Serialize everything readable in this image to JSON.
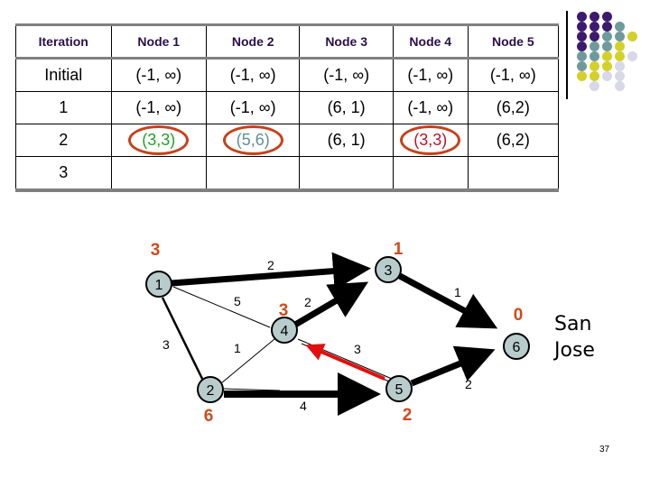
{
  "table": {
    "headers": [
      "Iteration",
      "Node 1",
      "Node 2",
      "Node 3",
      "Node 4",
      "Node 5"
    ],
    "rows": [
      {
        "iteration": "Initial",
        "cells": [
          "(-1, ∞)",
          "(-1, ∞)",
          "(-1, ∞)",
          "(-1, ∞)",
          "(-1, ∞)"
        ]
      },
      {
        "iteration": "1",
        "cells": [
          "(-1, ∞)",
          "(-1, ∞)",
          "(6, 1)",
          "(-1, ∞)",
          "(6,2)"
        ]
      },
      {
        "iteration": "2",
        "cells": [
          "(3,3)",
          "(5,6)",
          "(6, 1)",
          "(3,3)",
          "(6,2)"
        ]
      },
      {
        "iteration": "3",
        "cells": [
          "",
          "",
          "",
          "",
          ""
        ]
      }
    ],
    "highlighted": [
      {
        "row": 2,
        "col": 0,
        "color": "#22a02a"
      },
      {
        "row": 2,
        "col": 1,
        "color": "#5f8f95"
      },
      {
        "row": 2,
        "col": 3,
        "color": "#b4182a"
      }
    ],
    "circle_color": "#c8401a"
  },
  "graph": {
    "nodes": [
      {
        "id": "1",
        "distance": "3"
      },
      {
        "id": "2",
        "distance": "6"
      },
      {
        "id": "3",
        "distance": "1"
      },
      {
        "id": "4",
        "distance": "3"
      },
      {
        "id": "5",
        "distance": "2"
      },
      {
        "id": "6",
        "distance": "0"
      }
    ],
    "edges": [
      {
        "from": "1",
        "to": "3",
        "weight": "2",
        "style": "thick-arrow"
      },
      {
        "from": "1",
        "to": "4",
        "weight": "5",
        "style": "thin"
      },
      {
        "from": "1",
        "to": "2",
        "weight": "3",
        "style": "medium"
      },
      {
        "from": "2",
        "to": "4",
        "weight": "1",
        "style": "thin"
      },
      {
        "from": "2",
        "to": "5",
        "weight": "4",
        "style": "thick-arrow"
      },
      {
        "from": "4",
        "to": "3",
        "weight": "2",
        "style": "thick-arrow"
      },
      {
        "from": "5",
        "to": "4",
        "weight": "3",
        "style": "red-arrow"
      },
      {
        "from": "3",
        "to": "6",
        "weight": "1",
        "style": "thick-arrow"
      },
      {
        "from": "5",
        "to": "6",
        "weight": "2",
        "style": "thick-arrow"
      }
    ],
    "destination_label": [
      "San",
      "Jose"
    ],
    "colors": {
      "node_fill": "#b8cccc",
      "distance_text": "#d04a1a",
      "highlight_edge": "#e01010"
    }
  },
  "page_number": "37",
  "logo": {
    "colors": [
      "#3d1a6e",
      "#6f9a9c",
      "#d4d02a",
      "#d8d8e8"
    ]
  }
}
